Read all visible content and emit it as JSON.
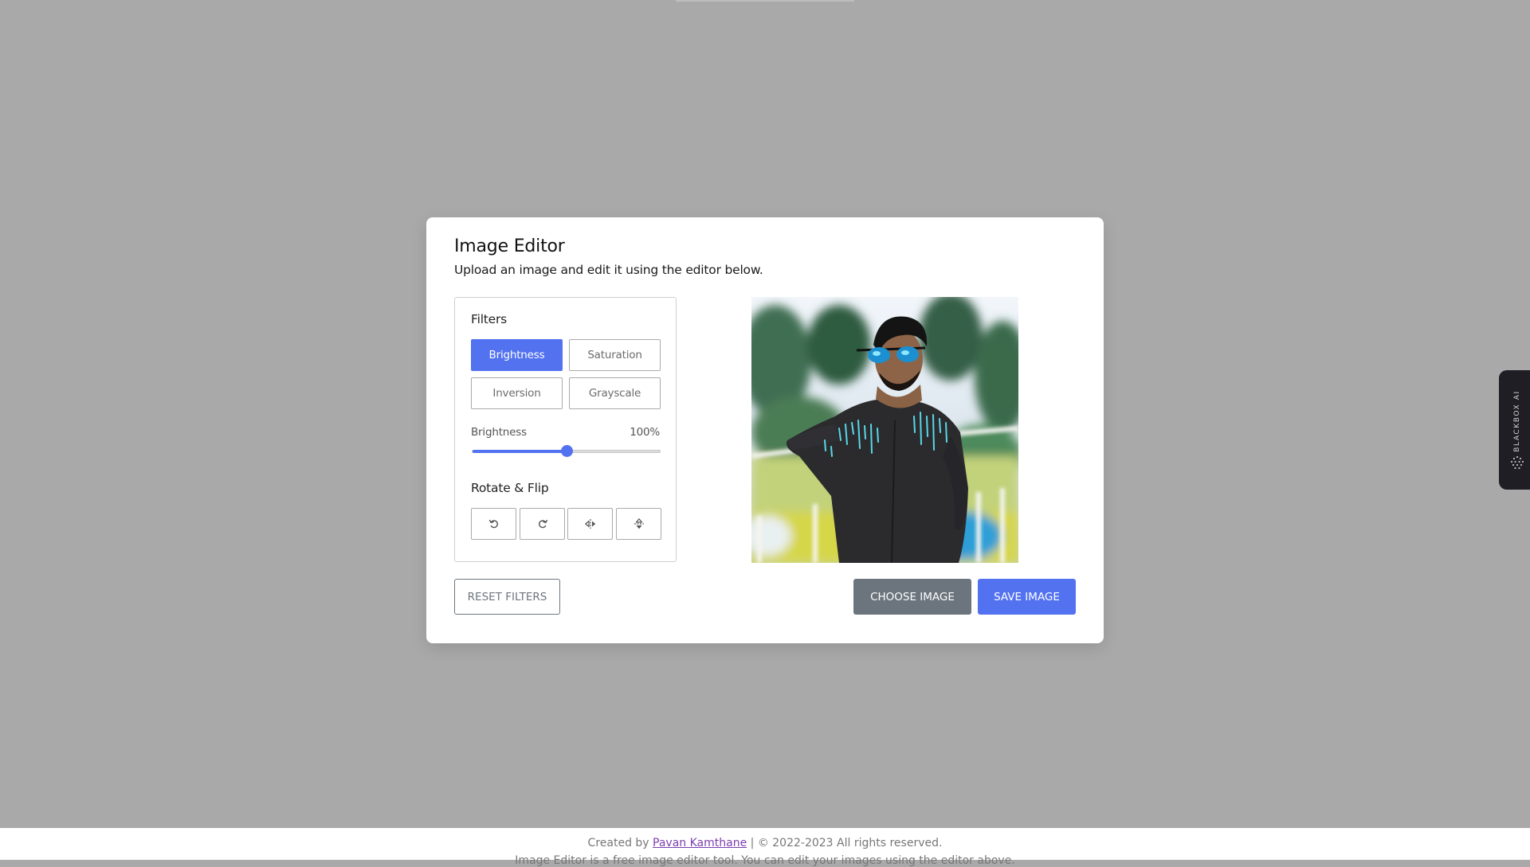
{
  "editor": {
    "title": "Image Editor",
    "subtitle": "Upload an image and edit it using the editor below."
  },
  "filters": {
    "heading": "Filters",
    "options": [
      {
        "label": "Brightness",
        "active": true
      },
      {
        "label": "Saturation",
        "active": false
      },
      {
        "label": "Inversion",
        "active": false
      },
      {
        "label": "Grayscale",
        "active": false
      }
    ],
    "slider": {
      "name": "Brightness",
      "value_text": "100%",
      "fraction": 0.5
    }
  },
  "rotate_flip": {
    "heading": "Rotate & Flip",
    "buttons": [
      {
        "icon": "rotate-left-icon"
      },
      {
        "icon": "rotate-right-icon"
      },
      {
        "icon": "flip-horizontal-icon"
      },
      {
        "icon": "flip-vertical-icon"
      }
    ]
  },
  "actions": {
    "reset": "RESET FILTERS",
    "choose": "CHOOSE IMAGE",
    "save": "SAVE IMAGE"
  },
  "footer": {
    "created_by": "Created by",
    "author": "Pavan Kamthane",
    "rights": "| © 2022-2023 All rights reserved.",
    "description": "Image Editor is a free image editor tool. You can edit your images using the editor above."
  },
  "side_widget": {
    "label": "BLACKBOX AI"
  },
  "colors": {
    "accent": "#5372f0",
    "secondary": "#6c757d",
    "backdrop": "#a9a9a9",
    "widget": "#1e1e24"
  }
}
